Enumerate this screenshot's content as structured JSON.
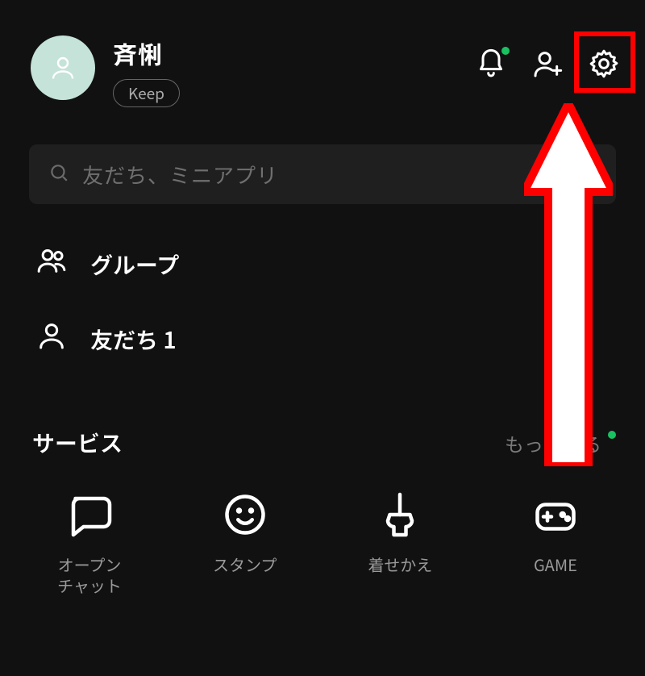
{
  "profile": {
    "username": "斉悧",
    "keep_label": "Keep"
  },
  "header_icons": {
    "bell": "bell-icon",
    "add_friend": "add-friend-icon",
    "settings": "gear-icon"
  },
  "search": {
    "placeholder": "友だち、ミニアプリ"
  },
  "list": {
    "groups_label": "グループ",
    "friends_label": "友だち 1"
  },
  "services": {
    "title": "サービス",
    "more_label": "もっと見る",
    "items": [
      {
        "label": "オープン\nチャット",
        "icon": "chat-bubble-icon"
      },
      {
        "label": "スタンプ",
        "icon": "smiley-icon"
      },
      {
        "label": "着せかえ",
        "icon": "brush-icon"
      },
      {
        "label": "GAME",
        "icon": "gamepad-icon"
      }
    ]
  },
  "annotation": {
    "highlight": "settings",
    "accent": "#ff0000"
  }
}
